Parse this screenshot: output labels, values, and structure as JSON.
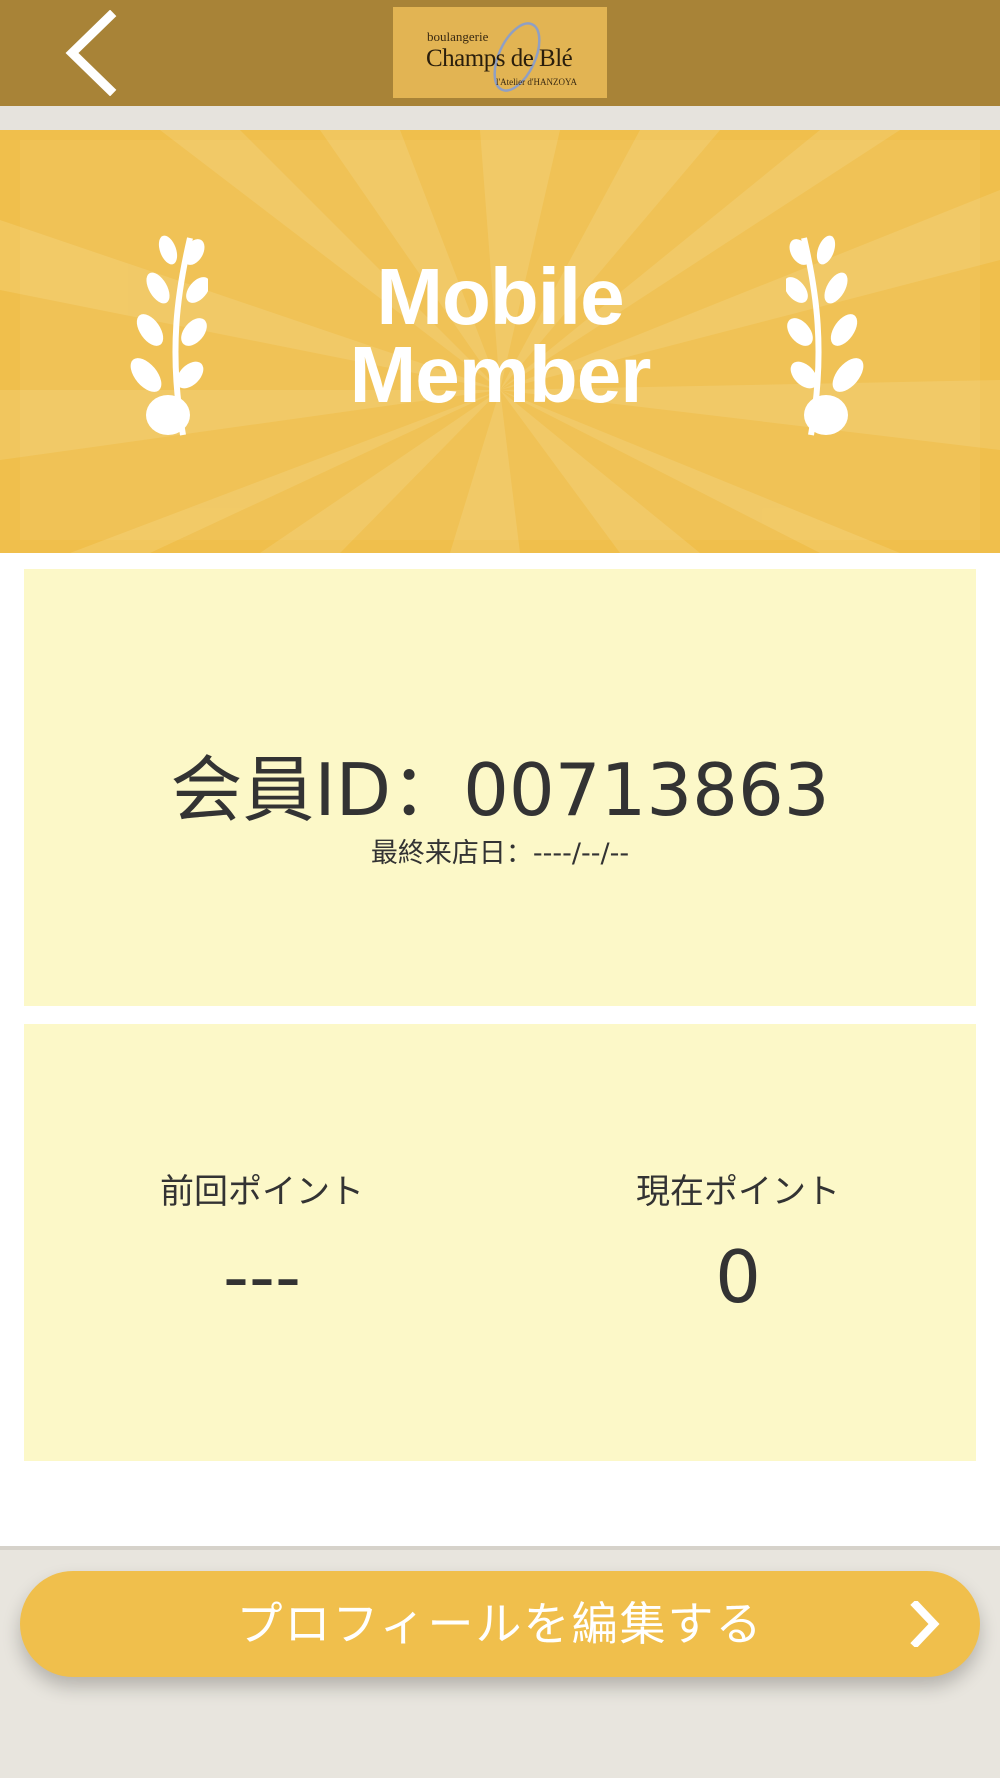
{
  "header": {
    "back_icon": "chevron-left-icon",
    "logo": {
      "small_text": "boulangerie",
      "brand_text": "Champs de Blé",
      "sub_text": "l'Atelier d'HANZOYA"
    }
  },
  "banner": {
    "title_line1": "Mobile",
    "title_line2": "Member",
    "left_icon": "laurel-branch-icon",
    "right_icon": "laurel-branch-icon"
  },
  "member_card": {
    "member_id_label": "会員ID：00713863",
    "last_visit": "最終来店日：----/--/--"
  },
  "points_card": {
    "previous_label": "前回ポイント",
    "previous_value": "---",
    "current_label": "現在ポイント",
    "current_value": "0"
  },
  "footer": {
    "edit_profile_label": "プロフィールを編集する",
    "edit_icon": "chevron-right-icon"
  },
  "colors": {
    "header_bg": "#a88337",
    "accent_yellow": "#f0bf4c",
    "card_bg": "#fcf8c8",
    "text": "#333333"
  }
}
